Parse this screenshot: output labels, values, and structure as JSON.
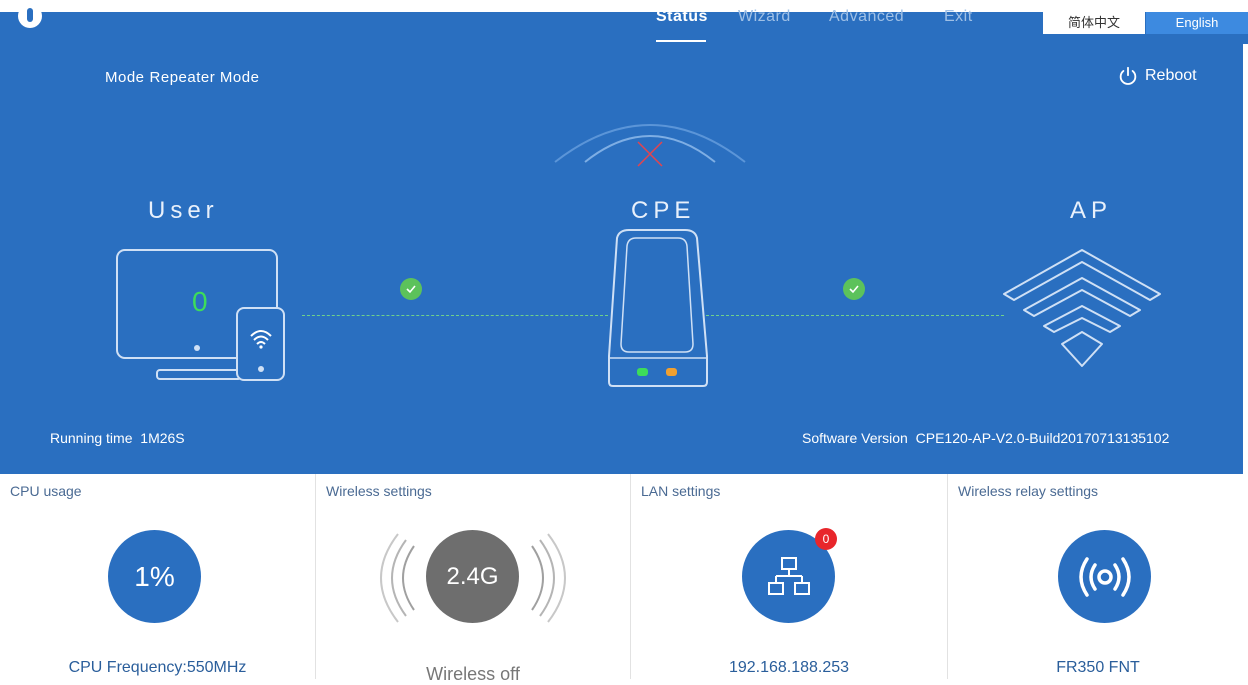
{
  "nav": {
    "items": [
      "Status",
      "Wizard",
      "Advanced",
      "Exit"
    ],
    "active": "Status"
  },
  "lang": {
    "chinese": "简体中文",
    "english": "English"
  },
  "mode": {
    "label": "Mode",
    "value": "Repeater Mode"
  },
  "reboot_label": "Reboot",
  "topology": {
    "user_label": "User",
    "cpe_label": "CPE",
    "ap_label": "AP",
    "user_count": "0",
    "link_user_status": "connected",
    "link_ap_status": "connected",
    "wireless_status": "disconnected"
  },
  "running": {
    "label": "Running time",
    "value": "1M26S"
  },
  "software": {
    "label": "Software Version",
    "value": "CPE120-AP-V2.0-Build20170713135102"
  },
  "cards": {
    "cpu": {
      "title": "CPU usage",
      "usage": "1%",
      "footer": "CPU Frequency:550MHz"
    },
    "wireless": {
      "title": "Wireless settings",
      "band": "2.4G",
      "footer": "Wireless off"
    },
    "lan": {
      "title": "LAN settings",
      "badge": "0",
      "footer": "192.168.188.253"
    },
    "relay": {
      "title": "Wireless relay settings",
      "footer": "FR350 FNT"
    }
  },
  "colors": {
    "primary": "#2a6fc0",
    "accent_green": "#5cc25b",
    "badge_red": "#e8262b",
    "circle_blue": "#2a6fc0",
    "circle_gray": "#6e6e6e"
  }
}
